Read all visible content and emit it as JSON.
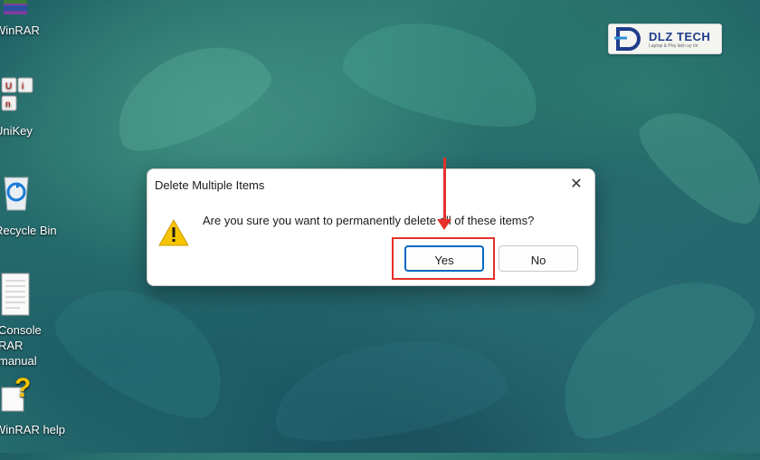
{
  "desktop": {
    "icons": [
      {
        "label": "WinRAR",
        "icon": "winrar-icon"
      },
      {
        "label": "UniKey",
        "icon": "unikey-icon"
      },
      {
        "label": "Recycle Bin",
        "icon": "recycle-bin-icon"
      },
      {
        "label": "Console RAR manual",
        "icon": "document-icon"
      },
      {
        "label": "WinRAR help",
        "icon": "help-icon"
      }
    ]
  },
  "watermark": {
    "brand": "DLZ TECH",
    "tagline": "Laptop & Phụ kiện uy tín"
  },
  "dialog": {
    "title": "Delete Multiple Items",
    "message": "Are you sure you want to permanently delete all of these items?",
    "buttons": {
      "yes": "Yes",
      "no": "No"
    },
    "close_glyph": "✕",
    "default_button": "yes"
  },
  "colors": {
    "accent": "#0067c0",
    "annotation_red": "#e5302b",
    "warning_yellow": "#f7c500"
  }
}
